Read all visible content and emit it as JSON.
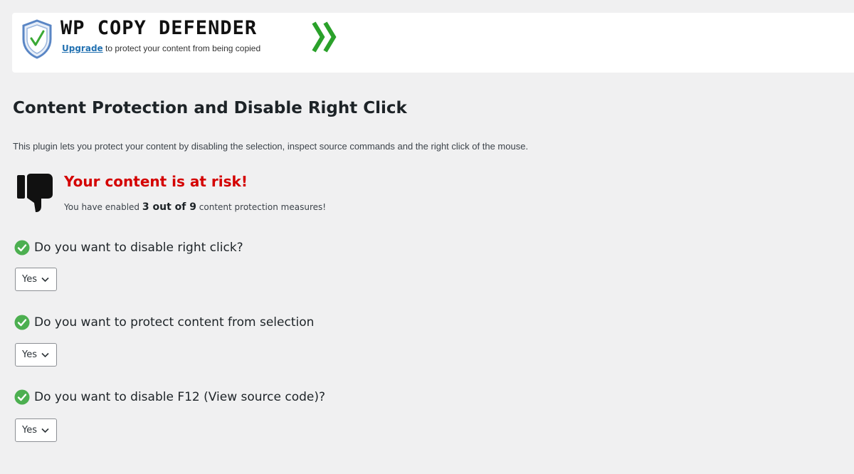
{
  "banner": {
    "title": "WP COPY DEFENDER",
    "upgrade_link": "Upgrade",
    "upgrade_text": " to protect your content from being copied"
  },
  "page": {
    "title": "Content Protection and Disable Right Click",
    "intro": "This plugin lets you protect your content by disabling the selection, inspect source commands and the right click of the mouse."
  },
  "risk": {
    "title": "Your content is at risk!",
    "prefix": "You have enabled ",
    "count": "3 out of 9",
    "suffix": " content protection measures!"
  },
  "settings": [
    {
      "question": "Do you want to disable right click?",
      "value": "Yes"
    },
    {
      "question": "Do you want to protect content from selection",
      "value": "Yes"
    },
    {
      "question": "Do you want to disable F12 (View source code)?",
      "value": "Yes"
    }
  ],
  "colors": {
    "risk": "#d40000",
    "check": "#4caf50",
    "chevron": "#2aa12a",
    "shield": "#5a86c5",
    "link": "#2271b1"
  },
  "icons": [
    "shield-check-icon",
    "double-chevron-icon",
    "thumbs-down-icon",
    "check-circle-icon",
    "chevron-down-icon"
  ]
}
